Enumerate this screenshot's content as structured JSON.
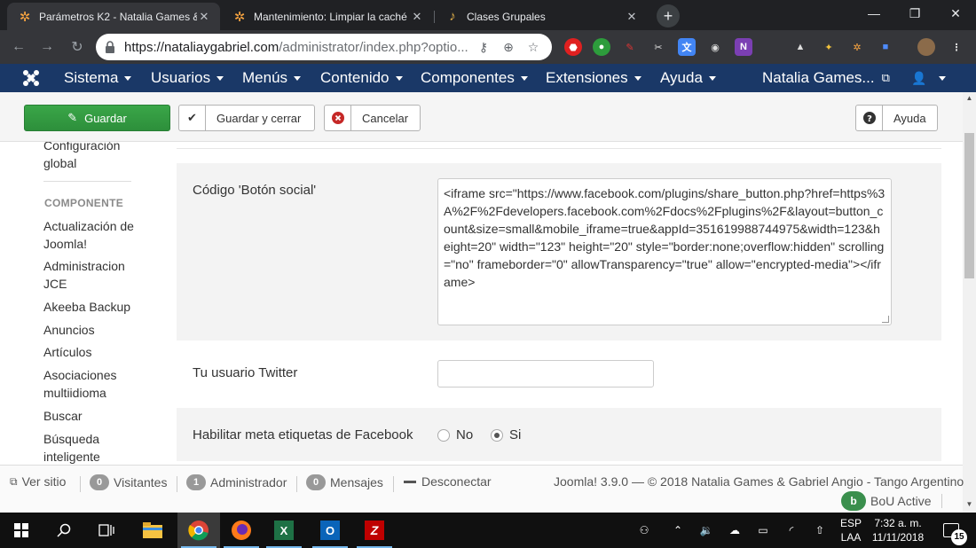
{
  "browser": {
    "tabs": [
      {
        "title": "Parámetros K2 - Natalia Games &",
        "active": true,
        "icon": "joomla-icon"
      },
      {
        "title": "Mantenimiento: Limpiar la caché",
        "active": false,
        "icon": "joomla-icon"
      },
      {
        "title": "Clases Grupales",
        "active": false,
        "icon": "dancers-icon"
      }
    ],
    "tab_close": "✕",
    "new_tab": "+",
    "url_host": "https://nataliaygabriel.com",
    "url_path": "/administrator/index.php?optio...",
    "window_controls": {
      "minimize": "—",
      "maximize": "❐",
      "close": "✕"
    }
  },
  "joomla": {
    "menu": [
      "Sistema",
      "Usuarios",
      "Menús",
      "Contenido",
      "Componentes",
      "Extensiones",
      "Ayuda"
    ],
    "site_name": "Natalia Games..."
  },
  "toolbar": {
    "save_label": "Guardar",
    "save_close_label": "Guardar y cerrar",
    "cancel_label": "Cancelar",
    "help_label": "Ayuda"
  },
  "sidebar": {
    "top_item": "Configuración global",
    "section_header": "COMPONENTE",
    "items": [
      "Actualización de Joomla!",
      "Administracion JCE",
      "Akeeba Backup",
      "Anuncios",
      "Artículos",
      "Asociaciones multiidioma",
      "Buscar",
      "Búsqueda inteligente"
    ]
  },
  "form": {
    "social_button": {
      "label": "Código 'Botón social'",
      "value": "<iframe src=\"https://www.facebook.com/plugins/share_button.php?href=https%3A%2F%2Fdevelopers.facebook.com%2Fdocs%2Fplugins%2F&layout=button_count&size=small&mobile_iframe=true&appId=351619988744975&width=123&height=20\" width=\"123\" height=\"20\" style=\"border:none;overflow:hidden\" scrolling=\"no\" frameborder=\"0\" allowTransparency=\"true\" allow=\"encrypted-media\"></iframe>"
    },
    "twitter": {
      "label": "Tu usuario Twitter",
      "value": ""
    },
    "facebook_meta": {
      "label": "Habilitar meta etiquetas de Facebook",
      "options": [
        "No",
        "Si"
      ],
      "selected": "Si"
    }
  },
  "status": {
    "view_site": "Ver sitio",
    "visitors_count": "0",
    "visitors_label": "Visitantes",
    "admin_count": "1",
    "admin_label": "Administrador",
    "messages_count": "0",
    "messages_label": "Mensajes",
    "logout_label": "Desconectar",
    "copyright": "Joomla! 3.9.0 — © 2018 Natalia Games & Gabriel Angio - Tango Argentino",
    "bou_label": "BoU Active"
  },
  "taskbar": {
    "lang": "ESP",
    "lang2": "LAA",
    "time": "7:32 a. m.",
    "date": "11/11/2018",
    "notifications": "15"
  },
  "colors": {
    "joomla_nav": "#1a3867",
    "save_green": "#2f9e44",
    "cancel_red": "#c52827"
  }
}
